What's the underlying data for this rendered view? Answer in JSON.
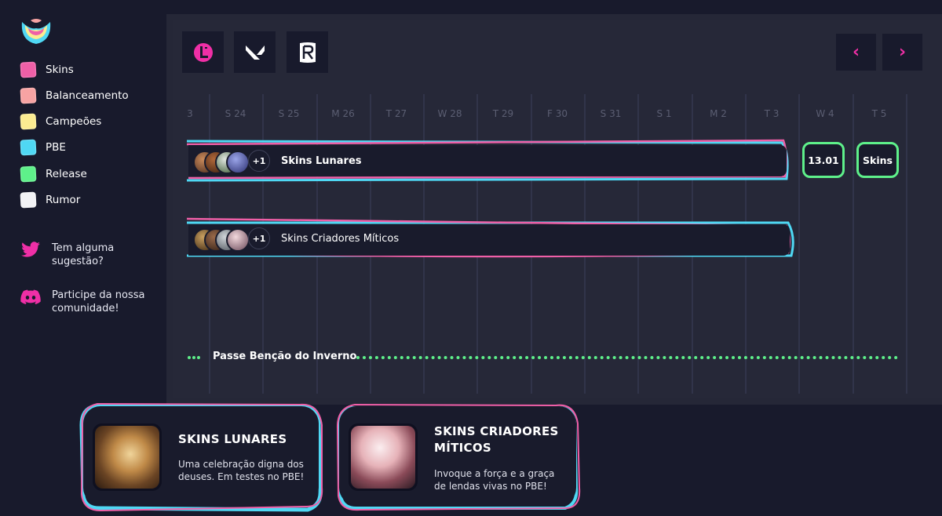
{
  "sidebar": {
    "legend": [
      {
        "label": "Skins",
        "color": "#ef5fa7"
      },
      {
        "label": "Balanceamento",
        "color": "#f7a3a3"
      },
      {
        "label": "Campeões",
        "color": "#fbeb91"
      },
      {
        "label": "PBE",
        "color": "#4fd8f4"
      },
      {
        "label": "Release",
        "color": "#5ef08a"
      },
      {
        "label": "Rumor",
        "color": "#f2f2f5"
      }
    ],
    "social": [
      {
        "icon": "twitter-icon",
        "text_lines": [
          "Tem alguma",
          "sugestão?"
        ]
      },
      {
        "icon": "discord-icon",
        "text_lines": [
          "Participe da nossa",
          "comunidade!"
        ]
      }
    ]
  },
  "toolbar": {
    "games": [
      "league-of-legends-icon",
      "valorant-icon",
      "legends-of-runeterra-icon"
    ],
    "prev_icon": "‹",
    "next_icon": "›"
  },
  "timeline": {
    "days": [
      "3",
      "S 24",
      "S 25",
      "M 26",
      "T 27",
      "W 28",
      "T 29",
      "F 30",
      "S 31",
      "S 1",
      "M 2",
      "T 3",
      "W 4",
      "T 5"
    ],
    "events": [
      {
        "label": "Skins Lunares",
        "extra_count": "+1"
      },
      {
        "label": "Skins Criadores Míticos",
        "extra_count": "+1"
      }
    ],
    "chips": [
      {
        "label": "13.01"
      },
      {
        "label": "Skins"
      }
    ],
    "pass": {
      "label": "Passe Benção do Inverno"
    }
  },
  "cards": [
    {
      "title": "SKINS LUNARES",
      "desc_lines": [
        "Uma celebração digna dos",
        "deuses. Em testes no PBE!"
      ]
    },
    {
      "title_lines": [
        "SKINS CRIADORES",
        "MÍTICOS"
      ],
      "desc_lines": [
        "Invoque a força e a graça",
        "de lendas vivas no PBE!"
      ]
    }
  ],
  "colors": {
    "accent": "#ef2fa6",
    "pbe": "#4fd8f4",
    "skins": "#ef5fa7",
    "release": "#5ef08a"
  }
}
